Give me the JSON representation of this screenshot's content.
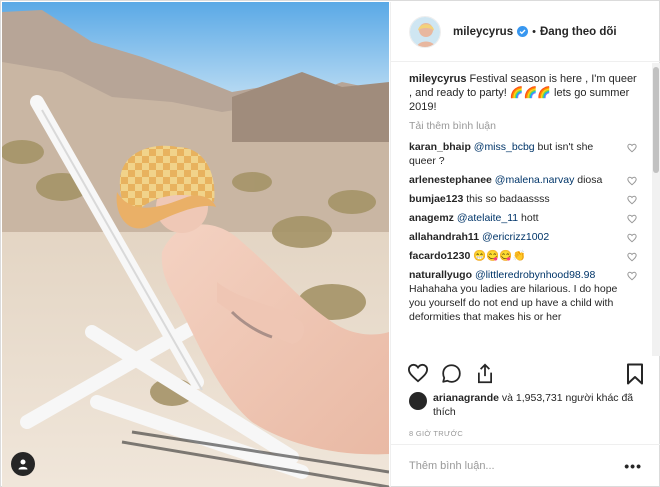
{
  "post": {
    "username": "mileycyrus",
    "follow_label": "Đang theo dõi",
    "caption_user": "mileycyrus",
    "caption_text": "Festival season is here , I'm queer , and ready to party! 🌈🌈🌈 lets go summer 2019!",
    "load_more": "Tải thêm bình luận",
    "comments": [
      {
        "user": "karan_bhaip",
        "mention": "@miss_bcbg",
        "text": " but isn't she queer ?"
      },
      {
        "user": "arlenestephanee",
        "mention": "@malena.narvay",
        "text": " diosa"
      },
      {
        "user": "bumjae123",
        "mention": "",
        "text": "this so badaassss"
      },
      {
        "user": "anagemz",
        "mention": "@atelaite_11",
        "text": " hott"
      },
      {
        "user": "allahandrah11",
        "mention": "@ericrizz1002",
        "text": ""
      },
      {
        "user": "facardo1230",
        "mention": "",
        "text": "😁😋😋👏"
      },
      {
        "user": "naturallyugo",
        "mention": "@littleredrobynhood98.98",
        "text": " Hahahaha you ladies are hilarious. I do hope you yourself do not end up have a child with deformities that makes his or her"
      }
    ],
    "likes_user": "arianagrande",
    "likes_text": " và 1,953,731 người khác đã thích",
    "time": "8 GIỜ TRƯỚC",
    "add_comment_placeholder": "Thêm bình luận...",
    "more_label": "•••"
  },
  "colors": {
    "sky": "#6fb6e8",
    "sand": "#e6d7c6",
    "verified": "#3897f0",
    "mention": "#003569"
  },
  "icons": [
    "user-tag-icon",
    "verified-badge-icon",
    "heart-icon",
    "comment-icon",
    "share-icon",
    "bookmark-icon"
  ]
}
